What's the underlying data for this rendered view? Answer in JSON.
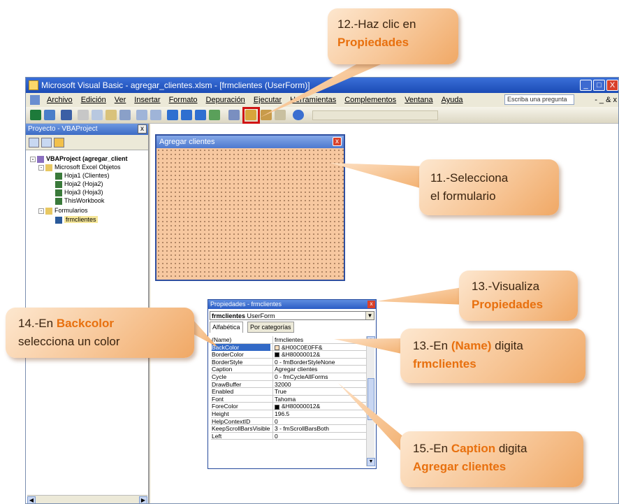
{
  "window": {
    "title": "Microsoft Visual Basic - agregar_clientes.xlsm - [frmclientes (UserForm)]",
    "buttons": [
      "_",
      "□",
      "X"
    ]
  },
  "menubar": {
    "items": [
      "Archivo",
      "Edición",
      "Ver",
      "Insertar",
      "Formato",
      "Depuración",
      "Ejecutar",
      "Herramientas",
      "Complementos",
      "Ventana",
      "Ayuda"
    ],
    "ask_placeholder": "Escriba una pregunta",
    "right_controls": "- _ & x"
  },
  "project_panel": {
    "title": "Proyecto - VBAProject",
    "close": "x",
    "tree": [
      {
        "label": "VBAProject (agregar_client",
        "level": 0,
        "bold": true,
        "toggle": "-"
      },
      {
        "label": "Microsoft Excel Objetos",
        "level": 1,
        "toggle": "-"
      },
      {
        "label": "Hoja1 (Clientes)",
        "level": 2
      },
      {
        "label": "Hoja2 (Hoja2)",
        "level": 2
      },
      {
        "label": "Hoja3 (Hoja3)",
        "level": 2
      },
      {
        "label": "ThisWorkbook",
        "level": 2
      },
      {
        "label": "Formularios",
        "level": 1,
        "toggle": "-"
      },
      {
        "label": "frmclientes",
        "level": 2,
        "selected": true
      }
    ]
  },
  "userform": {
    "caption": "Agregar clientes",
    "close": "x",
    "back_color": "#f7c8a0"
  },
  "properties": {
    "title": "Propiedades - frmclientes",
    "close": "x",
    "object_name": "frmclientes",
    "object_type": "UserForm",
    "tabs": [
      "Alfabética",
      "Por categorías"
    ],
    "rows": [
      {
        "key": "(Name)",
        "value": "frmclientes"
      },
      {
        "key": "BackColor",
        "value": "&H00C0E0FF&",
        "swatch": "#ffe0c0",
        "selected": true
      },
      {
        "key": "BorderColor",
        "value": "&H80000012&",
        "swatch": "#000000"
      },
      {
        "key": "BorderStyle",
        "value": "0 - fmBorderStyleNone"
      },
      {
        "key": "Caption",
        "value": "Agregar clientes"
      },
      {
        "key": "Cycle",
        "value": "0 - fmCycleAllForms"
      },
      {
        "key": "DrawBuffer",
        "value": "32000"
      },
      {
        "key": "Enabled",
        "value": "True"
      },
      {
        "key": "Font",
        "value": "Tahoma"
      },
      {
        "key": "ForeColor",
        "value": "&H80000012&",
        "swatch": "#000000"
      },
      {
        "key": "Height",
        "value": "196.5"
      },
      {
        "key": "HelpContextID",
        "value": "0"
      },
      {
        "key": "KeepScrollBarsVisible",
        "value": "3 - fmScrollBarsBoth"
      },
      {
        "key": "Left",
        "value": "0"
      }
    ]
  },
  "callouts": {
    "c12": {
      "line1": "12.-Haz clic  en",
      "line2": "Propiedades"
    },
    "c11": {
      "line1": "11.-Selecciona",
      "line2": "el formulario"
    },
    "c13a": {
      "line1": "13.-Visualiza",
      "line2": "Propiedades"
    },
    "c14": {
      "line1_pre": "14.-En ",
      "line1_hl": "Backcolor",
      "line2": "selecciona un color"
    },
    "c13b": {
      "line1_pre": "13.-En ",
      "line1_hl": "(Name)",
      "line1_post": " digita",
      "line2": "frmclientes"
    },
    "c15": {
      "line1_pre": "15.-En ",
      "line1_hl": "Caption",
      "line1_post": " digita",
      "line2": "Agregar clientes"
    }
  },
  "colors": {
    "callout_highlight": "#e8700e",
    "annotation_box": "#d01414",
    "titlebar": "#1b4bb5"
  }
}
